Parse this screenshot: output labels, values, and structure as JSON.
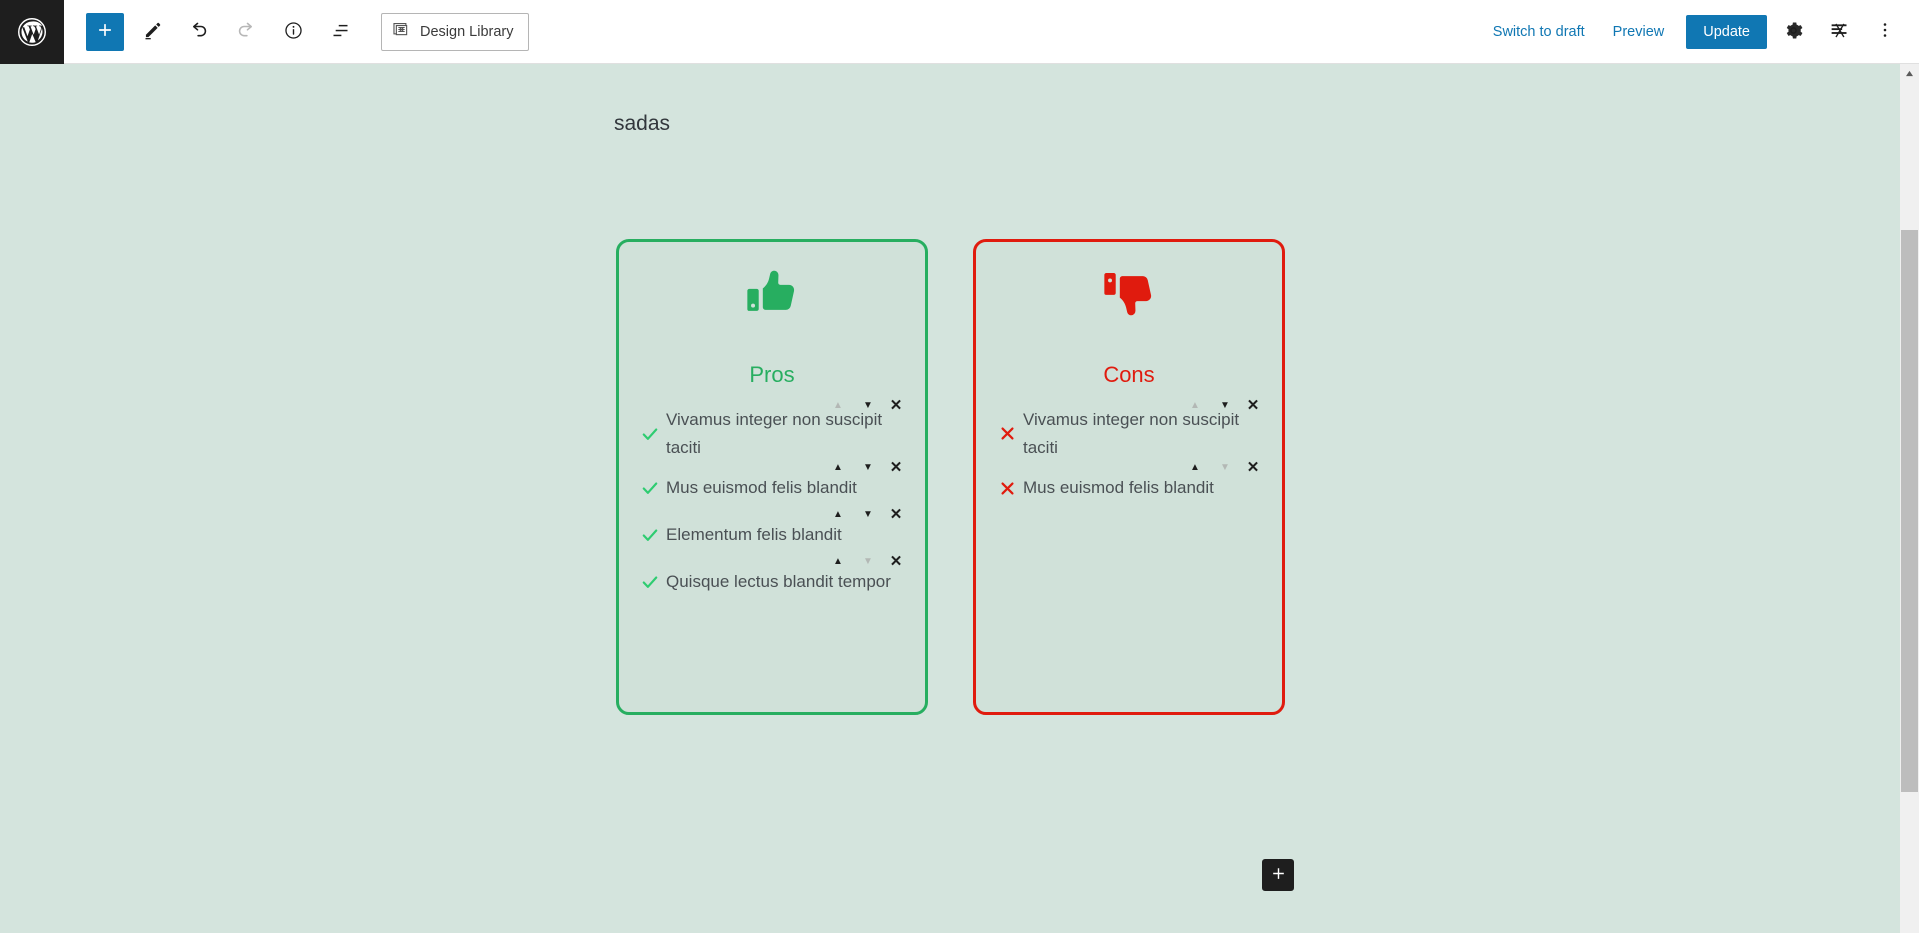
{
  "topbar": {
    "logo_icon": "wordpress-logo-icon",
    "tools": [
      {
        "name": "add-block-button",
        "icon": "plus-icon",
        "title": "Add block",
        "state": "primary"
      },
      {
        "name": "tools-button",
        "icon": "pencil-icon",
        "title": "Tools",
        "state": "default"
      },
      {
        "name": "undo-button",
        "icon": "undo-icon",
        "title": "Undo",
        "state": "default"
      },
      {
        "name": "redo-button",
        "icon": "redo-icon",
        "title": "Redo",
        "state": "disabled"
      },
      {
        "name": "details-button",
        "icon": "info-icon",
        "title": "Details",
        "state": "default"
      },
      {
        "name": "list-view-button",
        "icon": "list-view-icon",
        "title": "List View",
        "state": "default"
      }
    ],
    "design_library": {
      "label": "Design Library",
      "icon": "design-library-icon"
    },
    "switch_to_draft_label": "Switch to draft",
    "preview_label": "Preview",
    "update_label": "Update",
    "settings_icon": "gear-icon",
    "plugin_icon": "kadence-icon",
    "more_icon": "ellipsis-vertical-icon",
    "accent_color": "#1077b3",
    "logo_bg_color": "#1e1e1e"
  },
  "canvas": {
    "background_color": "#d4e4dd",
    "post_title": "sadas",
    "appender": {
      "name": "block-appender",
      "icon": "plus-icon",
      "label": "+"
    }
  },
  "pros_cons": {
    "pros": {
      "heading": "Pros",
      "icon": "thumbs-up-icon",
      "color": "#27ae60",
      "bullet_icon": "check-icon",
      "items": [
        {
          "text": "Vivamus integer non suscipit taciti",
          "move_up_enabled": false,
          "move_down_enabled": true
        },
        {
          "text": "Mus euismod felis blandit",
          "move_up_enabled": true,
          "move_down_enabled": true
        },
        {
          "text": "Elementum felis blandit",
          "move_up_enabled": true,
          "move_down_enabled": true
        },
        {
          "text": "Quisque lectus blandit tempor",
          "move_up_enabled": true,
          "move_down_enabled": false
        }
      ]
    },
    "cons": {
      "heading": "Cons",
      "icon": "thumbs-down-icon",
      "color": "#e01b0e",
      "bullet_icon": "cross-icon",
      "items": [
        {
          "text": "Vivamus integer non suscipit taciti",
          "move_up_enabled": false,
          "move_down_enabled": true
        },
        {
          "text": "Mus euismod felis blandit",
          "move_up_enabled": true,
          "move_down_enabled": false
        }
      ]
    },
    "controls": {
      "move_up_glyph": "▲",
      "move_down_glyph": "▼",
      "remove_glyph": "✕"
    }
  },
  "scrollbar": {
    "up_arrow_glyph": "▲"
  }
}
